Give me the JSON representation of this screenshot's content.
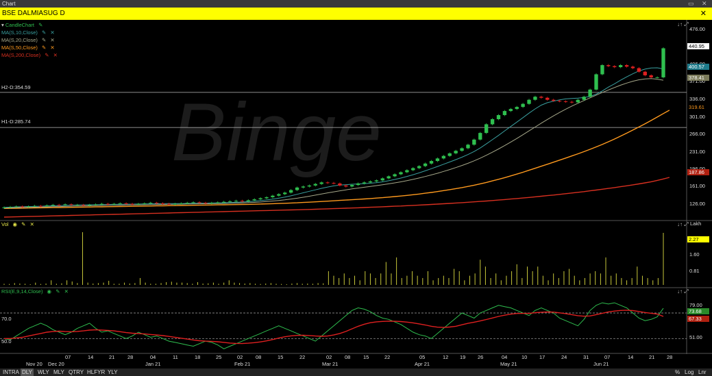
{
  "window": {
    "title": "Chart"
  },
  "symbol_bar": {
    "symbol": "BSE DALMIASUG D"
  },
  "price_pane": {
    "legend": [
      {
        "label": "CandleChart",
        "color": "#2fbf4f"
      },
      {
        "label": "MA(S,10,Close)",
        "color": "#3aa0a0"
      },
      {
        "label": "MA(S,20,Close)",
        "color": "#a6a88a"
      },
      {
        "label": "MA(S,50,Close)",
        "color": "#ff9a1e"
      },
      {
        "label": "MA(S,200,Close)",
        "color": "#d83020"
      }
    ],
    "hlines": [
      {
        "label": "H2-D:354.59",
        "value": 354.59
      },
      {
        "label": "H1-D:285.74",
        "value": 285.74
      }
    ],
    "ticks": [
      "476.00",
      "406.00",
      "371.00",
      "336.00",
      "301.00",
      "266.00",
      "231.00",
      "196.00",
      "161.00",
      "126.00"
    ],
    "badges": [
      {
        "text": "440.95",
        "bg": "#ffffff",
        "fg": "#000000"
      },
      {
        "text": "400.57",
        "bg": "#1e7a8a",
        "fg": "#ffffff"
      },
      {
        "text": "378.41",
        "bg": "#7a7a5a",
        "fg": "#ffffff"
      },
      {
        "text": "319.61",
        "bg": "#000000",
        "fg": "#ff9a1e"
      },
      {
        "text": "187.86",
        "bg": "#b02010",
        "fg": "#ffffff"
      }
    ]
  },
  "volume_pane": {
    "legend": "Vol",
    "unit": "Lakh",
    "ticks": [
      "1.60",
      "0.81"
    ],
    "badge": "2.27"
  },
  "rsi_pane": {
    "legend": "RSI(E,9,14,Close)",
    "left_labels": [
      "70.0",
      "50.0"
    ],
    "ticks": [
      "79.00",
      "51.00"
    ],
    "badges": [
      {
        "text": "73.68",
        "bg": "#2a8a2a",
        "fg": "#ffffff"
      },
      {
        "text": "67.33",
        "bg": "#b02010",
        "fg": "#ffffff"
      }
    ]
  },
  "x_axis": {
    "months": [
      "Nov 20",
      "Dec 20",
      "Jan 21",
      "Feb 21",
      "Mar 21",
      "Apr 21",
      "May 21",
      "Jun 21"
    ],
    "days": [
      "07",
      "14",
      "21",
      "28",
      "04",
      "11",
      "18",
      "25",
      "02",
      "08",
      "15",
      "22",
      "02",
      "08",
      "15",
      "22",
      "05",
      "12",
      "19",
      "26",
      "04",
      "10",
      "17",
      "24",
      "31",
      "07",
      "14",
      "21",
      "28"
    ]
  },
  "bottom_bar": {
    "timeframes": [
      "INTRA",
      "DLY",
      "WLY",
      "MLY",
      "QTRY",
      "HLFYR",
      "YLY"
    ],
    "active": "DLY",
    "right": [
      "%",
      "Log",
      "Lnr"
    ]
  },
  "watermark": "Binge",
  "chart_data": {
    "type": "candlestick",
    "title": "BSE DALMIASUG D",
    "ylim": [
      110,
      490
    ],
    "price": {
      "close": [
        129,
        130,
        131,
        130,
        131,
        132,
        131,
        133,
        134,
        133,
        135,
        134,
        134,
        133,
        134,
        135,
        136,
        135,
        136,
        137,
        136,
        135,
        136,
        137,
        138,
        137,
        136,
        135,
        136,
        137,
        138,
        139,
        138,
        137,
        138,
        139,
        140,
        141,
        142,
        141,
        143,
        145,
        147,
        149,
        152,
        155,
        158,
        163,
        168,
        170,
        172,
        175,
        178,
        177,
        176,
        172,
        170,
        173,
        176,
        178,
        180,
        182,
        186,
        190,
        194,
        198,
        202,
        206,
        210,
        215,
        220,
        225,
        230,
        235,
        240,
        245,
        252,
        262,
        275,
        292,
        302,
        310,
        318,
        322,
        326,
        332,
        340,
        346,
        344,
        340,
        338,
        337,
        336,
        335,
        340,
        346,
        360,
        390,
        408,
        406,
        404,
        408,
        405,
        402,
        395,
        388,
        384,
        384,
        441
      ],
      "open": [
        128,
        129,
        131,
        131,
        130,
        132,
        132,
        132,
        134,
        134,
        134,
        135,
        134,
        134,
        133,
        135,
        135,
        136,
        135,
        137,
        137,
        136,
        135,
        137,
        137,
        138,
        137,
        136,
        135,
        137,
        137,
        139,
        139,
        138,
        137,
        139,
        139,
        141,
        141,
        142,
        141,
        143,
        145,
        147,
        149,
        152,
        155,
        158,
        163,
        168,
        170,
        172,
        175,
        178,
        177,
        176,
        172,
        170,
        173,
        176,
        178,
        180,
        182,
        186,
        190,
        194,
        198,
        202,
        206,
        210,
        215,
        220,
        225,
        230,
        235,
        240,
        245,
        252,
        262,
        275,
        292,
        302,
        310,
        318,
        322,
        326,
        332,
        340,
        346,
        344,
        340,
        338,
        337,
        336,
        335,
        340,
        346,
        360,
        390,
        408,
        406,
        404,
        408,
        405,
        402,
        395,
        388,
        384,
        384
      ]
    },
    "ma10": [
      129,
      129.5,
      130,
      130.4,
      130.8,
      131,
      131.4,
      131.8,
      132.2,
      132.5,
      133,
      133.4,
      133.7,
      134,
      134.2,
      134.4,
      134.6,
      134.8,
      135,
      135.2,
      135.4,
      135.5,
      135.6,
      135.8,
      136,
      136.2,
      136.3,
      136.4,
      136.5,
      136.6,
      136.8,
      137,
      137.2,
      137.4,
      137.6,
      137.8,
      138.1,
      138.5,
      139,
      139.6,
      140.3,
      141.2,
      142.3,
      143.6,
      145.2,
      147,
      149.2,
      151.8,
      154.7,
      157.7,
      160.6,
      163.5,
      166.4,
      169,
      171.2,
      172.8,
      173.7,
      174.4,
      175,
      175.6,
      176.4,
      177.6,
      179.2,
      181.3,
      183.8,
      186.6,
      189.7,
      193.1,
      196.8,
      200.8,
      204.9,
      209.2,
      213.6,
      218.1,
      222.7,
      227.5,
      232.7,
      238.6,
      245.5,
      253.6,
      261.8,
      270.2,
      279,
      287.7,
      296.3,
      305,
      313.8,
      322.2,
      329.6,
      334.4,
      337.2,
      339.9,
      341.7,
      342.6,
      343.3,
      344.5,
      346.5,
      351,
      357.4,
      364.8,
      371.3,
      378.4,
      385,
      391,
      396.5,
      400.2,
      402.5,
      402.7,
      400.57
    ],
    "ma20": [
      128,
      128.3,
      128.6,
      128.9,
      129.2,
      129.5,
      129.8,
      130.1,
      130.4,
      130.7,
      131,
      131.3,
      131.6,
      131.9,
      132.2,
      132.5,
      132.8,
      133,
      133.2,
      133.4,
      133.6,
      133.8,
      134,
      134.2,
      134.4,
      134.6,
      134.8,
      135,
      135.2,
      135.4,
      135.6,
      135.8,
      136,
      136.2,
      136.4,
      136.6,
      136.8,
      137.1,
      137.4,
      137.8,
      138.3,
      138.9,
      139.6,
      140.5,
      141.5,
      142.6,
      143.9,
      145.4,
      147.1,
      149,
      151,
      153.1,
      155.3,
      157.5,
      159.6,
      161.6,
      163.5,
      165.3,
      167,
      168.6,
      170.2,
      171.8,
      173.4,
      175.2,
      177.1,
      179.2,
      181.5,
      184,
      186.7,
      189.6,
      192.7,
      196,
      199.5,
      203.2,
      207.1,
      211.2,
      215.6,
      220.4,
      225.6,
      231.3,
      237.3,
      243.6,
      250.2,
      257.1,
      264.2,
      271.5,
      279,
      286.6,
      294.2,
      301.5,
      308.5,
      315.2,
      321.6,
      327.6,
      333.2,
      338.6,
      343.9,
      349.1,
      354.2,
      359.2,
      364,
      368.6,
      372.8,
      376.4,
      379.2,
      381,
      381.6,
      380.4,
      378.41
    ],
    "ma50": [
      127,
      127.2,
      127.4,
      127.6,
      127.8,
      128,
      128.2,
      128.4,
      128.6,
      128.8,
      129,
      129.2,
      129.4,
      129.6,
      129.8,
      130,
      130.2,
      130.4,
      130.6,
      130.8,
      131,
      131.2,
      131.4,
      131.6,
      131.8,
      132,
      132.2,
      132.4,
      132.6,
      132.8,
      133,
      133.2,
      133.4,
      133.6,
      133.8,
      134,
      134.2,
      134.4,
      134.6,
      134.8,
      135,
      135.3,
      135.6,
      135.9,
      136.3,
      136.7,
      137.1,
      137.6,
      138.1,
      138.7,
      139.3,
      139.9,
      140.6,
      141.3,
      142,
      142.7,
      143.4,
      144.1,
      144.8,
      145.6,
      146.4,
      147.3,
      148.2,
      149.2,
      150.3,
      151.4,
      152.6,
      153.9,
      155.3,
      156.8,
      158.4,
      160.1,
      161.9,
      163.8,
      165.8,
      167.9,
      170.2,
      172.6,
      175.2,
      178,
      181,
      184.1,
      187.4,
      190.8,
      194.3,
      198,
      201.8,
      205.7,
      209.7,
      213.7,
      217.7,
      221.7,
      225.8,
      229.9,
      234.1,
      238.4,
      242.9,
      247.6,
      252.5,
      257.7,
      263.1,
      268.8,
      274.6,
      280.6,
      286.7,
      293,
      299.4,
      306.2,
      313,
      319.61
    ],
    "ma200": [
      110,
      110.3,
      110.6,
      110.9,
      111.2,
      111.5,
      111.8,
      112.1,
      112.4,
      112.7,
      113,
      113.3,
      113.6,
      113.9,
      114.2,
      114.5,
      114.8,
      115.1,
      115.4,
      115.7,
      116,
      116.3,
      116.6,
      116.9,
      117.2,
      117.5,
      117.8,
      118.1,
      118.4,
      118.7,
      119,
      119.3,
      119.6,
      119.9,
      120.2,
      120.5,
      120.8,
      121.1,
      121.4,
      121.7,
      122,
      122.3,
      122.6,
      122.9,
      123.2,
      123.5,
      123.8,
      124.1,
      124.4,
      124.7,
      125.1,
      125.5,
      125.9,
      126.3,
      126.7,
      127.1,
      127.5,
      127.9,
      128.3,
      128.8,
      129.3,
      129.8,
      130.3,
      130.8,
      131.3,
      131.8,
      132.4,
      133,
      133.6,
      134.2,
      134.8,
      135.5,
      136.2,
      136.9,
      137.6,
      138.3,
      139.1,
      139.9,
      140.7,
      141.6,
      142.5,
      143.4,
      144.4,
      145.4,
      146.4,
      147.5,
      148.6,
      149.7,
      150.9,
      152.1,
      153.3,
      154.6,
      155.9,
      157.2,
      158.6,
      160,
      161.5,
      163,
      164.6,
      166.2,
      167.9,
      169.6,
      171.4,
      173.2,
      175.1,
      177.1,
      179.3,
      182,
      184.8,
      187.86
    ],
    "volume": {
      "ylim": [
        0,
        2.6
      ],
      "values": [
        0.05,
        0.04,
        0.08,
        0.06,
        0.05,
        0.03,
        0.1,
        0.04,
        0.06,
        0.2,
        0.05,
        0.07,
        0.2,
        0.15,
        0.08,
        2.3,
        0.1,
        0.06,
        0.08,
        0.1,
        0.18,
        0.05,
        0.05,
        0.1,
        0.06,
        0.08,
        0.3,
        0.1,
        0.05,
        0.05,
        0.08,
        0.12,
        0.14,
        0.1,
        0.1,
        0.08,
        0.05,
        0.12,
        0.06,
        0.07,
        0.1,
        0.05,
        0.1,
        0.2,
        0.1,
        0.08,
        0.06,
        0.08,
        0.05,
        0.04,
        0.06,
        0.08,
        0.05,
        0.04,
        0.03,
        0.06,
        0.08,
        0.05,
        0.06,
        0.05,
        0.08,
        0.07,
        0.6,
        0.4,
        0.3,
        0.5,
        0.3,
        0.4,
        0.2,
        0.6,
        0.5,
        0.3,
        0.5,
        1.0,
        0.5,
        1.2,
        0.3,
        0.4,
        0.6,
        0.4,
        0.3,
        0.6,
        0.2,
        0.3,
        0.4,
        0.3,
        0.7,
        0.6,
        0.2,
        0.4,
        0.5,
        1.1,
        0.8,
        0.3,
        0.5,
        0.2,
        0.4,
        0.6,
        0.9,
        0.3,
        0.8,
        0.6,
        0.8,
        0.4,
        0.2,
        0.5,
        0.3,
        0.6,
        0.7,
        0.4,
        0.2,
        0.3,
        0.5,
        0.6,
        0.5,
        1.2,
        0.4,
        0.5,
        0.3,
        0.2,
        0.3,
        0.8,
        0.4,
        0.3,
        0.2,
        0.3,
        2.27
      ]
    },
    "rsi": {
      "ylim": [
        40,
        85
      ],
      "rsi": [
        50,
        49,
        52,
        55,
        58,
        60,
        62,
        60,
        57,
        55,
        53,
        55,
        58,
        60,
        62,
        58,
        55,
        56,
        54,
        52,
        50,
        52,
        55,
        53,
        51,
        52,
        50,
        48,
        47,
        46,
        45,
        44,
        46,
        48,
        47,
        45,
        42,
        44,
        46,
        48,
        50,
        52,
        54,
        56,
        58,
        60,
        58,
        56,
        54,
        52,
        50,
        48,
        52,
        56,
        60,
        64,
        68,
        72,
        74,
        73,
        71,
        68,
        66,
        65,
        63,
        61,
        58,
        55,
        53,
        52,
        50,
        54,
        58,
        62,
        66,
        70,
        68,
        66,
        70,
        72,
        74,
        76,
        75,
        74,
        72,
        70,
        68,
        72,
        74,
        72,
        70,
        66,
        64,
        62,
        60,
        65,
        72,
        76,
        78,
        77,
        78,
        76,
        74,
        70,
        66,
        64,
        65,
        67,
        73.68
      ],
      "signal": [
        50,
        50,
        50.5,
        51,
        52,
        53,
        54,
        55,
        55.5,
        55.8,
        55.5,
        55.3,
        55.6,
        56,
        56.6,
        56.8,
        56.6,
        56.4,
        56,
        55.4,
        54.7,
        54.2,
        53.9,
        53.6,
        53.2,
        52.8,
        52.3,
        51.7,
        51,
        50.3,
        49.6,
        48.9,
        48.3,
        48,
        47.8,
        47.5,
        47,
        46.5,
        46.2,
        46.1,
        46.4,
        46.8,
        47.4,
        48.2,
        49.2,
        50.4,
        51.4,
        52.1,
        52.5,
        52.6,
        52.4,
        52,
        51.8,
        52,
        52.8,
        54,
        55.6,
        57.6,
        59.6,
        61.2,
        62.4,
        63.1,
        63.4,
        63.6,
        63.5,
        63.3,
        62.9,
        62.3,
        61.5,
        60.6,
        59.6,
        58.9,
        58.7,
        59,
        59.6,
        60.8,
        61.9,
        62.8,
        63.8,
        64.9,
        66.1,
        67.3,
        68.3,
        69.1,
        69.6,
        69.7,
        69.7,
        70.2,
        70.6,
        70.8,
        70.7,
        70.1,
        69.5,
        68.7,
        67.9,
        67.5,
        67.7,
        68.7,
        69.8,
        70.8,
        71.5,
        72,
        72.2,
        71.9,
        71.2,
        70.4,
        69.8,
        69.2,
        67.33
      ],
      "levels": [
        70.0,
        50.0
      ]
    }
  }
}
